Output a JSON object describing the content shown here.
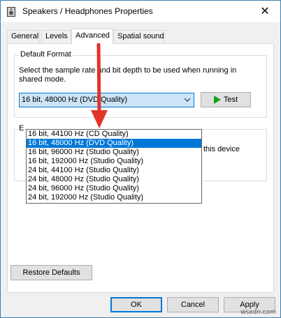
{
  "window": {
    "title": "Speakers / Headphones Properties",
    "close_glyph": "✕"
  },
  "tabs": [
    {
      "label": "General",
      "active": false
    },
    {
      "label": "Levels",
      "active": false
    },
    {
      "label": "Advanced",
      "active": true
    },
    {
      "label": "Spatial sound",
      "active": false
    }
  ],
  "default_format": {
    "legend": "Default Format",
    "description": "Select the sample rate and bit depth to be used when running in shared mode.",
    "selected_value": "16 bit, 48000 Hz (DVD Quality)",
    "test_label": "Test",
    "options": [
      "16 bit, 44100 Hz (CD Quality)",
      "16 bit, 48000 Hz (DVD Quality)",
      "16 bit, 96000 Hz (Studio Quality)",
      "16 bit, 192000 Hz (Studio Quality)",
      "24 bit, 44100 Hz (Studio Quality)",
      "24 bit, 48000 Hz (Studio Quality)",
      "24 bit, 96000 Hz (Studio Quality)",
      "24 bit, 192000 Hz (Studio Quality)"
    ],
    "selected_index": 1
  },
  "exclusive_mode": {
    "legend_fragment": "E",
    "checkbox1_fragment": "this device"
  },
  "buttons": {
    "restore_defaults": "Restore Defaults",
    "ok": "OK",
    "cancel": "Cancel",
    "apply": "Apply"
  },
  "watermark": "wsxdn.com",
  "colors": {
    "accent": "#0078d7",
    "selection_bg": "#cce4f7",
    "annotation_arrow": "#e0342a",
    "play_green": "#1aa01a"
  }
}
